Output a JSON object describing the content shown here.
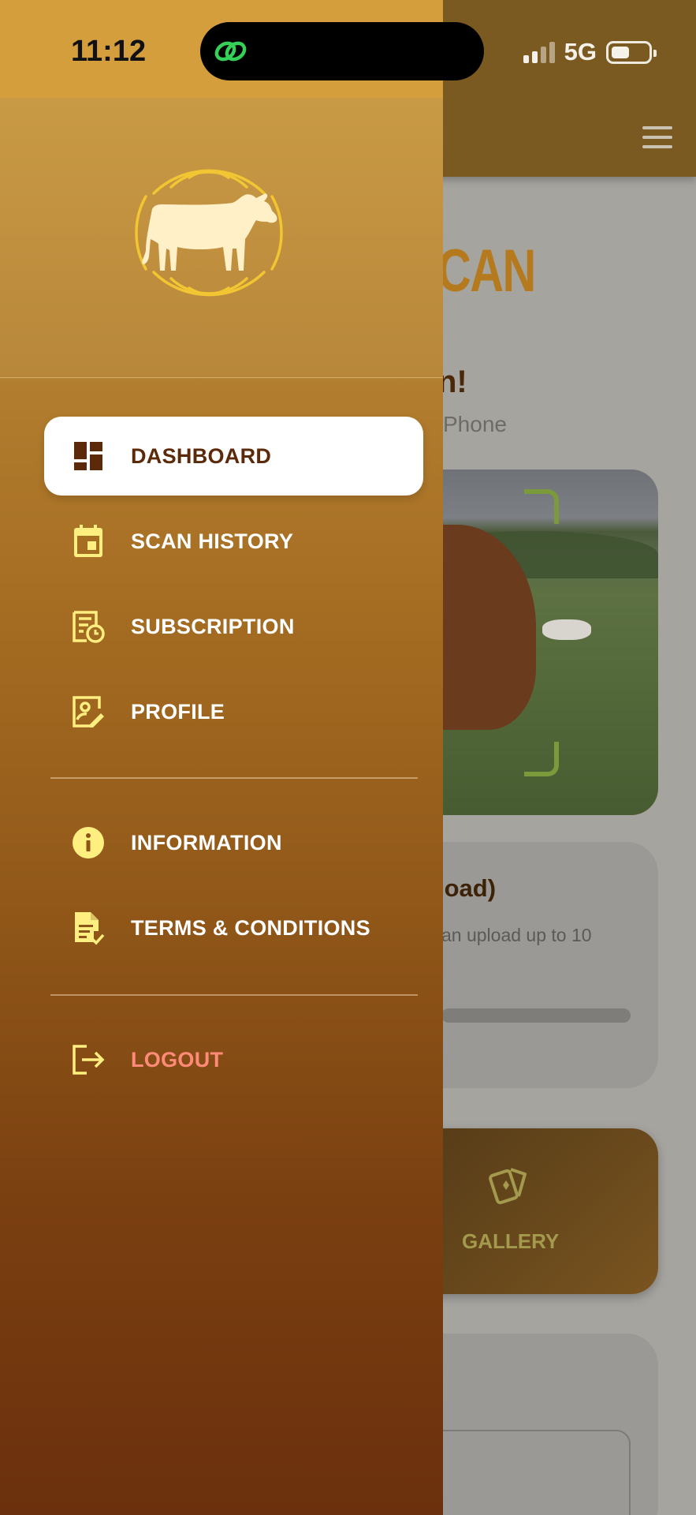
{
  "status_bar": {
    "time": "11:12",
    "network": "5G"
  },
  "background": {
    "title_fragment": "CAN",
    "greeting_fragment": "n!",
    "subtitle_fragment": "Phone",
    "upload_card": {
      "title_fragment": "load)",
      "text_fragment": "an upload up to 10"
    },
    "gallery_label": "GALLERY"
  },
  "drawer": {
    "items": [
      {
        "label": "DASHBOARD",
        "icon": "dashboard-icon",
        "active": true
      },
      {
        "label": "SCAN HISTORY",
        "icon": "calendar-icon"
      },
      {
        "label": "SUBSCRIPTION",
        "icon": "receipt-clock-icon"
      },
      {
        "label": "PROFILE",
        "icon": "profile-edit-icon"
      },
      {
        "label": "INFORMATION",
        "icon": "info-icon"
      },
      {
        "label": "TERMS & CONDITIONS",
        "icon": "document-check-icon"
      },
      {
        "label": "LOGOUT",
        "icon": "logout-icon"
      }
    ]
  },
  "colors": {
    "drawer_top": "#c6943f",
    "drawer_bottom": "#6b300d",
    "icon_yellow": "#ffee80",
    "active_text": "#5b2a0a",
    "logout_text": "#ff8a78",
    "logo_ring": "#f1c632",
    "logo_cow": "#fff0c8"
  }
}
